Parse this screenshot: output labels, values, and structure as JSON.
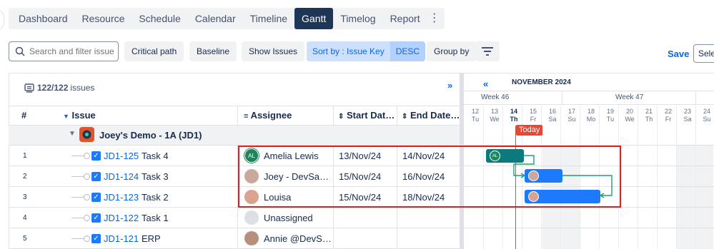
{
  "tabs": [
    {
      "label": "Dashboard"
    },
    {
      "label": "Resource"
    },
    {
      "label": "Schedule"
    },
    {
      "label": "Calendar"
    },
    {
      "label": "Timeline"
    },
    {
      "label": "Gantt"
    },
    {
      "label": "Timelog"
    },
    {
      "label": "Report"
    }
  ],
  "active_tab": "Gantt",
  "toolbar": {
    "search_placeholder": "Search and filter issue",
    "critical_path": "Critical path",
    "baseline": "Baseline",
    "show_issues": "Show Issues",
    "sort_by": "Sort by : Issue Key",
    "sort_dir": "DESC",
    "group_by": "Group by",
    "save": "Save",
    "select": "Sele"
  },
  "grid": {
    "issues_count": "122/122",
    "issues_label": "issues",
    "expand": "»",
    "headers": {
      "num": "#",
      "issue": "Issue",
      "assignee": "Assignee",
      "start": "Start Dat…",
      "end": "End Date…"
    },
    "group": {
      "title": "Joey's Demo - 1A  (JD1)"
    },
    "rows": [
      {
        "num": "1",
        "key": "JD1-125",
        "summary": "Task 4",
        "assignee": "Amelia Lewis",
        "avatar_text": "AL",
        "start": "13/Nov/24",
        "end": "14/Nov/24"
      },
      {
        "num": "2",
        "key": "JD1-124",
        "summary": "Task 3",
        "assignee": "Joey - DevSa…",
        "avatar_text": "",
        "start": "15/Nov/24",
        "end": "16/Nov/24"
      },
      {
        "num": "3",
        "key": "JD1-123",
        "summary": "Task 2",
        "assignee": "Louisa",
        "avatar_text": "",
        "start": "15/Nov/24",
        "end": "18/Nov/24"
      },
      {
        "num": "4",
        "key": "JD1-122",
        "summary": "Task 1",
        "assignee": "Unassigned",
        "avatar_text": "",
        "start": "",
        "end": ""
      },
      {
        "num": "5",
        "key": "JD1-121",
        "summary": "ERP",
        "assignee": "Annie @DevS…",
        "avatar_text": "",
        "start": "",
        "end": ""
      }
    ]
  },
  "gantt": {
    "back": "«",
    "month": "NOVEMBER 2024",
    "weeks": [
      {
        "label": "Week 46"
      },
      {
        "label": "Week 47"
      }
    ],
    "days": [
      {
        "num": "12",
        "dow": "Tu"
      },
      {
        "num": "13",
        "dow": "We"
      },
      {
        "num": "14",
        "dow": "Th"
      },
      {
        "num": "15",
        "dow": "Fr"
      },
      {
        "num": "16",
        "dow": "Sa"
      },
      {
        "num": "17",
        "dow": "Su"
      },
      {
        "num": "18",
        "dow": "Mo"
      },
      {
        "num": "19",
        "dow": "Tu"
      },
      {
        "num": "20",
        "dow": "We"
      },
      {
        "num": "21",
        "dow": "Th"
      },
      {
        "num": "22",
        "dow": "Fr"
      },
      {
        "num": "23",
        "dow": "Sa"
      },
      {
        "num": "24",
        "dow": "Su"
      }
    ],
    "today_label": "Today",
    "bars": [
      {
        "issue": "JD1-125",
        "avatar_text": "AL",
        "color": "#0b7a80"
      },
      {
        "issue": "JD1-124",
        "avatar_text": "",
        "color": "#1d7afc"
      },
      {
        "issue": "JD1-123",
        "avatar_text": "",
        "color": "#1d7afc"
      }
    ],
    "dependency_color": "#22a06b"
  },
  "colors": {
    "accent": "#0c66e4",
    "today": "#e34935",
    "active_tab": "#1d3557",
    "highlight": "#e02020"
  }
}
